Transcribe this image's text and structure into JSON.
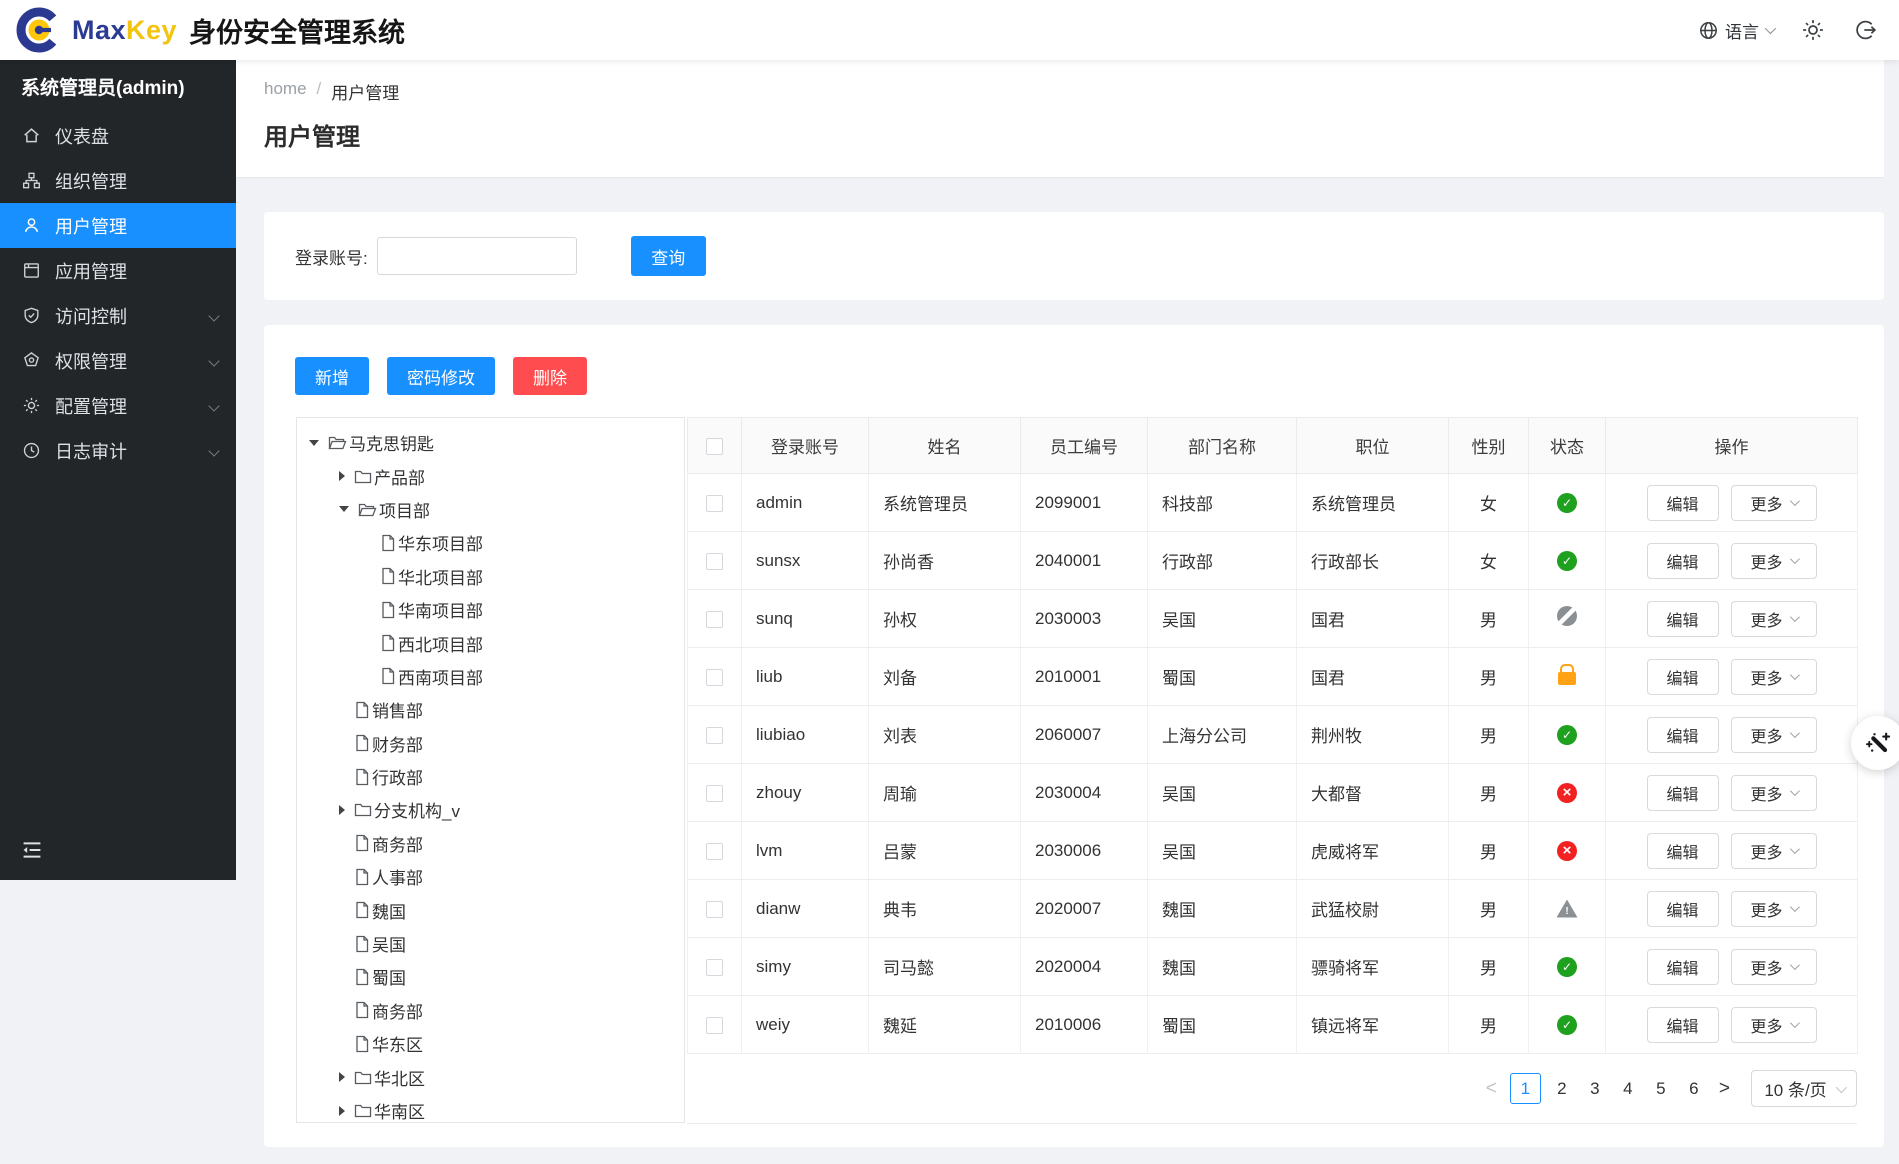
{
  "topbar": {
    "brand_max": "Max",
    "brand_key": "Key",
    "title": "身份安全管理系统",
    "language_label": "语言"
  },
  "colors": {
    "primary_blue": "#1890ff",
    "danger_red": "#ff4d4f",
    "status_green": "#1fa01f",
    "status_red": "#f32222",
    "status_orange": "#ffa214",
    "status_gray": "#8a9094",
    "sidebar_bg": "#222629"
  },
  "sidebar": {
    "user": "系统管理员(admin)",
    "items": [
      {
        "label": "仪表盘",
        "icon": "dashboard-icon",
        "active": false,
        "expandable": false
      },
      {
        "label": "组织管理",
        "icon": "organization-icon",
        "active": false,
        "expandable": false
      },
      {
        "label": "用户管理",
        "icon": "user-icon",
        "active": true,
        "expandable": false
      },
      {
        "label": "应用管理",
        "icon": "application-icon",
        "active": false,
        "expandable": false
      },
      {
        "label": "访问控制",
        "icon": "shield-icon",
        "active": false,
        "expandable": true
      },
      {
        "label": "权限管理",
        "icon": "badge-icon",
        "active": false,
        "expandable": true
      },
      {
        "label": "配置管理",
        "icon": "gear-icon",
        "active": false,
        "expandable": true
      },
      {
        "label": "日志审计",
        "icon": "clock-icon",
        "active": false,
        "expandable": true
      }
    ]
  },
  "breadcrumb": {
    "home": "home",
    "separator": "/",
    "current": "用户管理"
  },
  "page": {
    "title": "用户管理"
  },
  "search": {
    "label": "登录账号:",
    "input_value": "",
    "query_button": "查询"
  },
  "toolbar": {
    "add": "新增",
    "change_password": "密码修改",
    "delete": "删除"
  },
  "tree": {
    "items": [
      {
        "label": "马克思钥匙",
        "level": 1,
        "type": "open"
      },
      {
        "label": "产品部",
        "level": 2,
        "type": "closed"
      },
      {
        "label": "项目部",
        "level": 2,
        "type": "open"
      },
      {
        "label": "华东项目部",
        "level": 3,
        "type": "leaf"
      },
      {
        "label": "华北项目部",
        "level": 3,
        "type": "leaf"
      },
      {
        "label": "华南项目部",
        "level": 3,
        "type": "leaf"
      },
      {
        "label": "西北项目部",
        "level": 3,
        "type": "leaf"
      },
      {
        "label": "西南项目部",
        "level": 3,
        "type": "leaf"
      },
      {
        "label": "销售部",
        "level": 2,
        "type": "leaf"
      },
      {
        "label": "财务部",
        "level": 2,
        "type": "leaf"
      },
      {
        "label": "行政部",
        "level": 2,
        "type": "leaf"
      },
      {
        "label": "分支机构_v",
        "level": 2,
        "type": "closed"
      },
      {
        "label": "商务部",
        "level": 2,
        "type": "leaf"
      },
      {
        "label": "人事部",
        "level": 2,
        "type": "leaf"
      },
      {
        "label": "魏国",
        "level": 2,
        "type": "leaf"
      },
      {
        "label": "吴国",
        "level": 2,
        "type": "leaf"
      },
      {
        "label": "蜀国",
        "level": 2,
        "type": "leaf"
      },
      {
        "label": "商务部",
        "level": 2,
        "type": "leaf"
      },
      {
        "label": "华东区",
        "level": 2,
        "type": "leaf"
      },
      {
        "label": "华北区",
        "level": 2,
        "type": "closed"
      },
      {
        "label": "华南区",
        "level": 2,
        "type": "closed"
      }
    ]
  },
  "table": {
    "headers": [
      "登录账号",
      "姓名",
      "员工编号",
      "部门名称",
      "职位",
      "性别",
      "状态",
      "操作"
    ],
    "edit_label": "编辑",
    "more_label": "更多",
    "rows": [
      {
        "account": "admin",
        "name": "系统管理员",
        "employee_id": "2099001",
        "department": "科技部",
        "position": "系统管理员",
        "gender": "女",
        "status": "check"
      },
      {
        "account": "sunsx",
        "name": "孙尚香",
        "employee_id": "2040001",
        "department": "行政部",
        "position": "行政部长",
        "gender": "女",
        "status": "check"
      },
      {
        "account": "sunq",
        "name": "孙权",
        "employee_id": "2030003",
        "department": "吴国",
        "position": "国君",
        "gender": "男",
        "status": "ban"
      },
      {
        "account": "liub",
        "name": "刘备",
        "employee_id": "2010001",
        "department": "蜀国",
        "position": "国君",
        "gender": "男",
        "status": "lock"
      },
      {
        "account": "liubiao",
        "name": "刘表",
        "employee_id": "2060007",
        "department": "上海分公司",
        "position": "荆州牧",
        "gender": "男",
        "status": "check"
      },
      {
        "account": "zhouy",
        "name": "周瑜",
        "employee_id": "2030004",
        "department": "吴国",
        "position": "大都督",
        "gender": "男",
        "status": "cross"
      },
      {
        "account": "lvm",
        "name": "吕蒙",
        "employee_id": "2030006",
        "department": "吴国",
        "position": "虎威将军",
        "gender": "男",
        "status": "cross"
      },
      {
        "account": "dianw",
        "name": "典韦",
        "employee_id": "2020007",
        "department": "魏国",
        "position": "武猛校尉",
        "gender": "男",
        "status": "warn"
      },
      {
        "account": "simy",
        "name": "司马懿",
        "employee_id": "2020004",
        "department": "魏国",
        "position": "骠骑将军",
        "gender": "男",
        "status": "check"
      },
      {
        "account": "weiy",
        "name": "魏延",
        "employee_id": "2010006",
        "department": "蜀国",
        "position": "镇远将军",
        "gender": "男",
        "status": "check"
      }
    ]
  },
  "pagination": {
    "prev": "<",
    "next": ">",
    "pages": [
      "1",
      "2",
      "3",
      "4",
      "5",
      "6"
    ],
    "active_page": "1",
    "page_size": "10 条/页"
  }
}
